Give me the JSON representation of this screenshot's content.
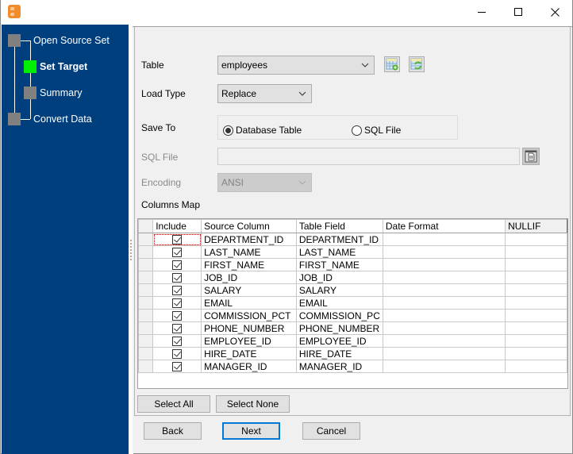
{
  "window": {
    "title": "",
    "controls": {
      "minimize": "minimize",
      "maximize": "maximize",
      "close": "close"
    }
  },
  "sidebar": {
    "steps": [
      {
        "label": "Open Source Set",
        "state": "done"
      },
      {
        "label": "Set Target",
        "state": "active"
      },
      {
        "label": "Summary",
        "state": "pending"
      },
      {
        "label": "Convert Data",
        "state": "pending"
      }
    ],
    "colors": {
      "background": "#003f7e",
      "active": "#00ee00",
      "inactive": "#808080"
    }
  },
  "form": {
    "table_label": "Table",
    "table_value": "employees",
    "load_type_label": "Load Type",
    "load_type_value": "Replace",
    "save_to_label": "Save To",
    "save_to_options": [
      {
        "label": "Database Table",
        "checked": true
      },
      {
        "label": "SQL File",
        "checked": false
      }
    ],
    "sql_file_label": "SQL File",
    "sql_file_value": "",
    "encoding_label": "Encoding",
    "encoding_value": "ANSI",
    "columns_map_label": "Columns Map"
  },
  "grid": {
    "columns": [
      "Include",
      "Source Column",
      "Table Field",
      "Date Format",
      "NULLIF"
    ],
    "rows": [
      {
        "include": true,
        "source": "DEPARTMENT_ID",
        "field": "DEPARTMENT_ID",
        "date_format": "",
        "nullif": ""
      },
      {
        "include": true,
        "source": "LAST_NAME",
        "field": "LAST_NAME",
        "date_format": "",
        "nullif": ""
      },
      {
        "include": true,
        "source": "FIRST_NAME",
        "field": "FIRST_NAME",
        "date_format": "",
        "nullif": ""
      },
      {
        "include": true,
        "source": "JOB_ID",
        "field": "JOB_ID",
        "date_format": "",
        "nullif": ""
      },
      {
        "include": true,
        "source": "SALARY",
        "field": "SALARY",
        "date_format": "",
        "nullif": ""
      },
      {
        "include": true,
        "source": "EMAIL",
        "field": "EMAIL",
        "date_format": "",
        "nullif": ""
      },
      {
        "include": true,
        "source": "COMMISSION_PCT",
        "field": "COMMISSION_PC",
        "date_format": "",
        "nullif": ""
      },
      {
        "include": true,
        "source": "PHONE_NUMBER",
        "field": "PHONE_NUMBER",
        "date_format": "",
        "nullif": ""
      },
      {
        "include": true,
        "source": "EMPLOYEE_ID",
        "field": "EMPLOYEE_ID",
        "date_format": "",
        "nullif": ""
      },
      {
        "include": true,
        "source": "HIRE_DATE",
        "field": "HIRE_DATE",
        "date_format": "",
        "nullif": ""
      },
      {
        "include": true,
        "source": "MANAGER_ID",
        "field": "MANAGER_ID",
        "date_format": "",
        "nullif": ""
      }
    ]
  },
  "buttons": {
    "select_all": "Select All",
    "select_none": "Select None",
    "back": "Back",
    "next": "Next",
    "cancel": "Cancel"
  }
}
